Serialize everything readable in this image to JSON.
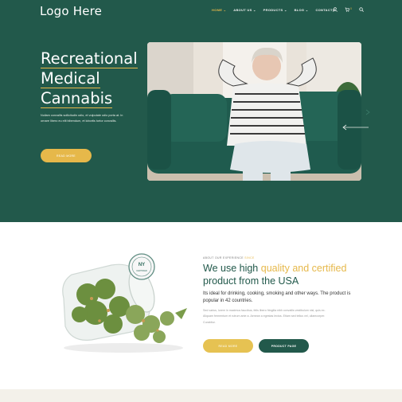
{
  "brand": {
    "logo": "Logo Here"
  },
  "nav": {
    "items": [
      {
        "label": "HOME",
        "chevron": "⌄"
      },
      {
        "label": "ABOUT US",
        "chevron": "⌄"
      },
      {
        "label": "PRODUCTS",
        "chevron": "⌄"
      },
      {
        "label": "BLOG",
        "chevron": "⌄"
      },
      {
        "label": "CONTACTS",
        "chevron": ""
      }
    ],
    "cart_count": "0"
  },
  "hero": {
    "headline": [
      "Recreational",
      "Medical",
      "Cannabis"
    ],
    "description": "Nullam convallis sollicitudin odio, et vulputate odio porta at. In ornare libero eu elit bibendum, et lobortis tortor convallis.",
    "button": "READ MORE"
  },
  "about": {
    "eyebrow": "ABOUT OUR EXPERIENCE",
    "eyebrow_accent": "SINCE",
    "heading_start": "We use high",
    "heading_accent": "quality and certified",
    "heading_end": "product from the USA",
    "subtext": "Its ideal for drinking, cooking, smoking and other ways. The product is popular in 42 countries.",
    "body": "Sed varius, lorem in maximus faucibus, felis libero fringilla nibh convallis vestibulum nisl, quis ex. Aliquam fermentum et rutrum ante a. Aenean a egestas lectus. Etiam sed tellus vel, ullamcorper. Curabitur.",
    "button_primary": "READ MORE",
    "button_secondary": "PRODUCT PAGE",
    "stamp": [
      "NY",
      "CERTIFIED"
    ]
  },
  "colors": {
    "primary": "#22594b",
    "accent": "#e6b84a",
    "footer_strip": "#f3f1ea"
  }
}
